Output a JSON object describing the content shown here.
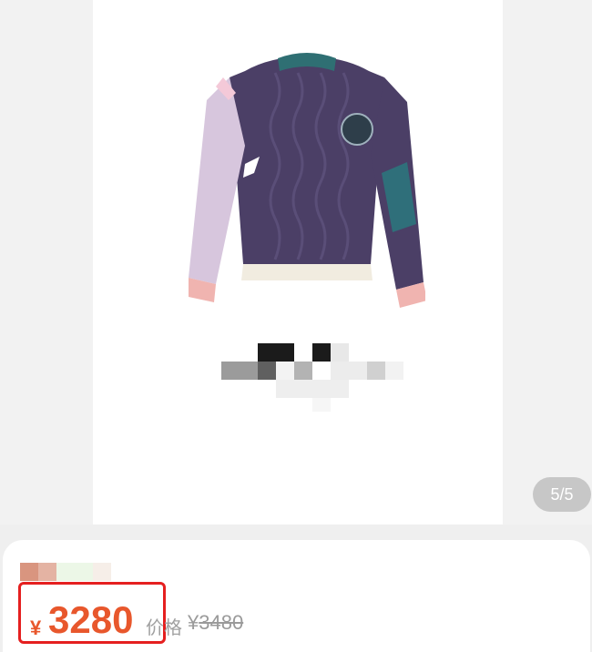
{
  "gallery": {
    "page_indicator": "5/5",
    "image_alt": "sweater product photo"
  },
  "product": {
    "currency_symbol": "¥",
    "price": "3280",
    "original_price_label": "价格",
    "original_currency_symbol": "¥",
    "original_price": "3480"
  },
  "colors": {
    "price": "#e8572c",
    "highlight_box": "#e51f1f",
    "sweater_main": "#4b3f66",
    "sweater_collar": "#2f6f73",
    "sweater_sleeve_left": "#d7c6dd",
    "sweater_hem": "#f1ece0",
    "sweater_cuff": "#f0b4b0",
    "pocket": "#2f6f7a"
  }
}
